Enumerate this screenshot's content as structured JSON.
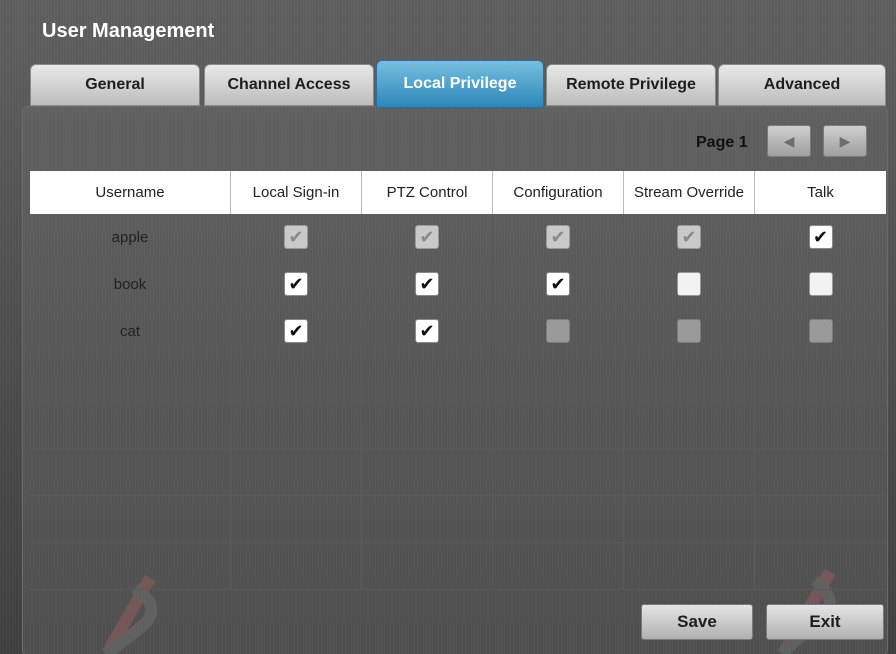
{
  "window": {
    "title": "User Management"
  },
  "tabs": [
    {
      "label": "General",
      "active": false
    },
    {
      "label": "Channel Access",
      "active": false
    },
    {
      "label": "Local Privilege",
      "active": true
    },
    {
      "label": "Remote Privilege",
      "active": false
    },
    {
      "label": "Advanced",
      "active": false
    }
  ],
  "pagination": {
    "label": "Page 1",
    "prev_icon": "left-arrow-icon",
    "next_icon": "right-arrow-icon"
  },
  "table": {
    "columns": [
      "Username",
      "Local Sign-in",
      "PTZ Control",
      "Configuration",
      "Stream Override",
      "Talk"
    ],
    "rows": [
      {
        "username": "apple",
        "values": [
          "checked-disabled",
          "checked-disabled",
          "checked-disabled",
          "checked-disabled",
          "checked"
        ]
      },
      {
        "username": "book",
        "values": [
          "checked",
          "checked",
          "checked",
          "unchecked",
          "unchecked"
        ]
      },
      {
        "username": "cat",
        "values": [
          "checked",
          "checked",
          "unchecked-disabled",
          "unchecked-disabled",
          "unchecked-disabled"
        ]
      }
    ],
    "empty_rows": 5
  },
  "buttons": {
    "save": "Save",
    "exit": "Exit"
  },
  "colors": {
    "active_tab": "#2b87b9",
    "background": "#4f4f4f"
  }
}
